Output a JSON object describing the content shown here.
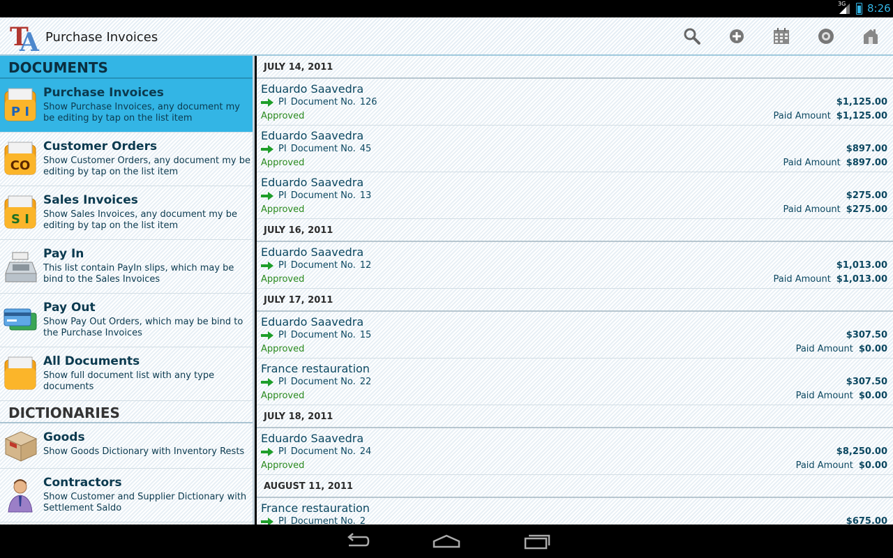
{
  "status_bar": {
    "network": "3G",
    "time": "8:26"
  },
  "app_bar": {
    "title": "Purchase Invoices",
    "logo_text": "TA",
    "actions": [
      "search-icon",
      "add-icon",
      "calendar-icon",
      "settings-icon",
      "home-icon"
    ]
  },
  "left_panel": {
    "documents_header": "DOCUMENTS",
    "documents": [
      {
        "title": "Purchase Invoices",
        "desc": "Show Purchase Invoices, any document my be editing by tap on the list item",
        "icon_text": "P I"
      },
      {
        "title": "Customer Orders",
        "desc": "Show Customer Orders, any document my be editing by tap on the list item",
        "icon_text": "CO"
      },
      {
        "title": "Sales Invoices",
        "desc": "Show Sales Invoices, any document my be editing by tap on the list item",
        "icon_text": "S I"
      },
      {
        "title": "Pay In",
        "desc": "This list contain PayIn slips, which may be bind to the Sales Invoices"
      },
      {
        "title": "Pay Out",
        "desc": "Show Pay Out Orders, which may be bind to the Purchase Invoices"
      },
      {
        "title": "All Documents",
        "desc": "Show full document list with any type documents"
      }
    ],
    "dictionaries_header": "DICTIONARIES",
    "dictionaries": [
      {
        "title": "Goods",
        "desc": "Show Goods Dictionary with Inventory Rests"
      },
      {
        "title": "Contractors",
        "desc": "Show Customer and Supplier Dictionary with Settlement Saldo"
      }
    ]
  },
  "doc_list": {
    "groups": [
      {
        "date": "JULY 14, 2011",
        "rows": [
          {
            "party": "Eduardo Saavedra",
            "type": "PI",
            "doc_label": "Document No.",
            "doc_no": "126",
            "status": "Approved",
            "amount": "$1,125.00",
            "paid_label": "Paid Amount",
            "paid": "$1,125.00"
          },
          {
            "party": "Eduardo Saavedra",
            "type": "PI",
            "doc_label": "Document No.",
            "doc_no": "45",
            "status": "Approved",
            "amount": "$897.00",
            "paid_label": "Paid Amount",
            "paid": "$897.00"
          },
          {
            "party": "Eduardo Saavedra",
            "type": "PI",
            "doc_label": "Document No.",
            "doc_no": "13",
            "status": "Approved",
            "amount": "$275.00",
            "paid_label": "Paid Amount",
            "paid": "$275.00"
          }
        ]
      },
      {
        "date": "JULY 16, 2011",
        "rows": [
          {
            "party": "Eduardo Saavedra",
            "type": "PI",
            "doc_label": "Document No.",
            "doc_no": "12",
            "status": "Approved",
            "amount": "$1,013.00",
            "paid_label": "Paid Amount",
            "paid": "$1,013.00"
          }
        ]
      },
      {
        "date": "JULY 17, 2011",
        "rows": [
          {
            "party": "Eduardo Saavedra",
            "type": "PI",
            "doc_label": "Document No.",
            "doc_no": "15",
            "status": "Approved",
            "amount": "$307.50",
            "paid_label": "Paid Amount",
            "paid": "$0.00"
          },
          {
            "party": "France restauration",
            "type": "PI",
            "doc_label": "Document No.",
            "doc_no": "22",
            "status": "Approved",
            "amount": "$307.50",
            "paid_label": "Paid Amount",
            "paid": "$0.00"
          }
        ]
      },
      {
        "date": "JULY 18, 2011",
        "rows": [
          {
            "party": "Eduardo Saavedra",
            "type": "PI",
            "doc_label": "Document No.",
            "doc_no": "24",
            "status": "Approved",
            "amount": "$8,250.00",
            "paid_label": "Paid Amount",
            "paid": "$0.00"
          }
        ]
      },
      {
        "date": "AUGUST 11, 2011",
        "rows": [
          {
            "party": "France restauration",
            "type": "PI",
            "doc_label": "Document No.",
            "doc_no": "2",
            "status": "",
            "amount": "$675.00",
            "paid_label": "",
            "paid": ""
          }
        ]
      }
    ]
  },
  "colors": {
    "accent": "#33b5e5",
    "approved": "#2a8a1e",
    "text_dark": "#0b3a4f"
  }
}
